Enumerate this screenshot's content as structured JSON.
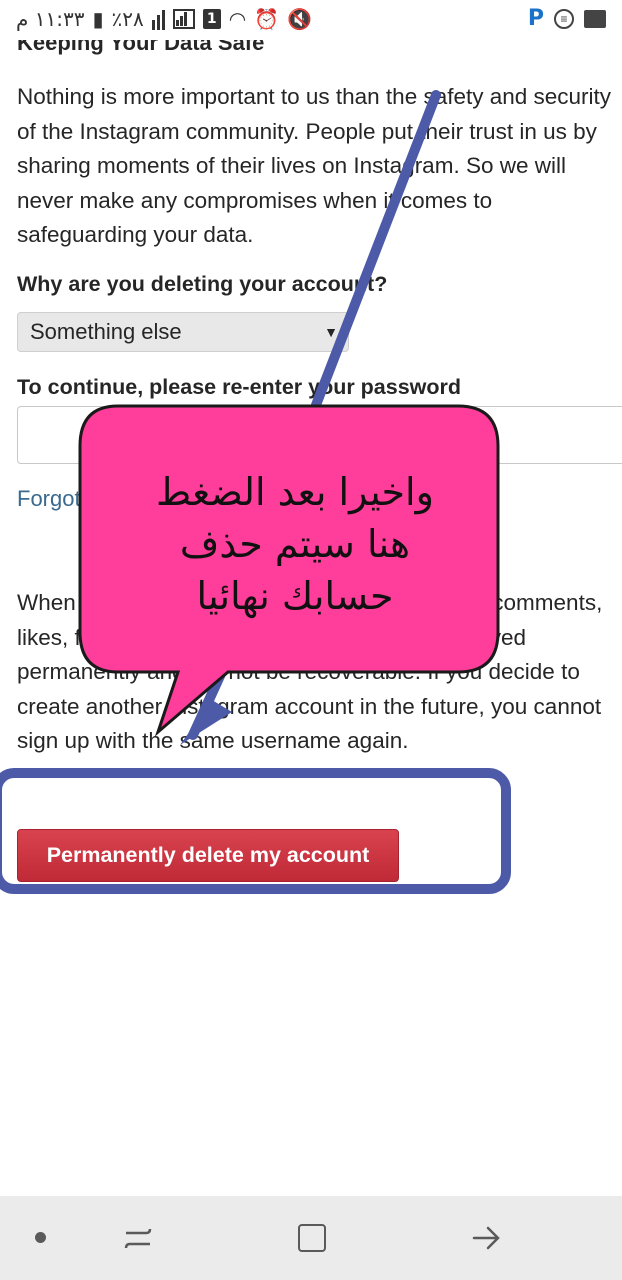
{
  "status_bar": {
    "time": "١١:٣٣ م",
    "battery": "٪٢٨",
    "sim_slot": "1",
    "icons": [
      "battery-icon",
      "signal-icon",
      "sim-icon",
      "wifi-icon",
      "alarm-icon",
      "mute-icon",
      "app-p-icon",
      "circle-icon",
      "gallery-icon"
    ]
  },
  "page": {
    "heading": "Keeping Your Data Safe",
    "paragraph": "Nothing is more important to us than the safety and security of the Instagram community. People put their trust in us by sharing moments of their lives on Instagram. So we will never make any compromises when it comes to safeguarding your data.",
    "reason_label": "Why are you deleting your account?",
    "reason_selected": "Something else",
    "password_label": "To continue, please re-enter your password",
    "password_value": "",
    "forgot_link": "Forgot password?",
    "warning_text": "When you press the button below, your photos, comments, likes, friendships and all other data will be removed permanently and will not be recoverable. If you decide to create another Instagram account in the future, you cannot sign up with the same username again.",
    "delete_button": "Permanently delete my account"
  },
  "annotation": {
    "callout_text": "واخيرا بعد الضغط\nهنا سيتم حذف\nحسابك نهائيا",
    "callout_color": "#ff3d9a",
    "arrow_color": "#4d5aa8",
    "frame_color": "#4d5aa8"
  },
  "nav_bar": {
    "icons": [
      "dot-icon",
      "recent-apps-icon",
      "home-icon",
      "back-icon"
    ]
  }
}
